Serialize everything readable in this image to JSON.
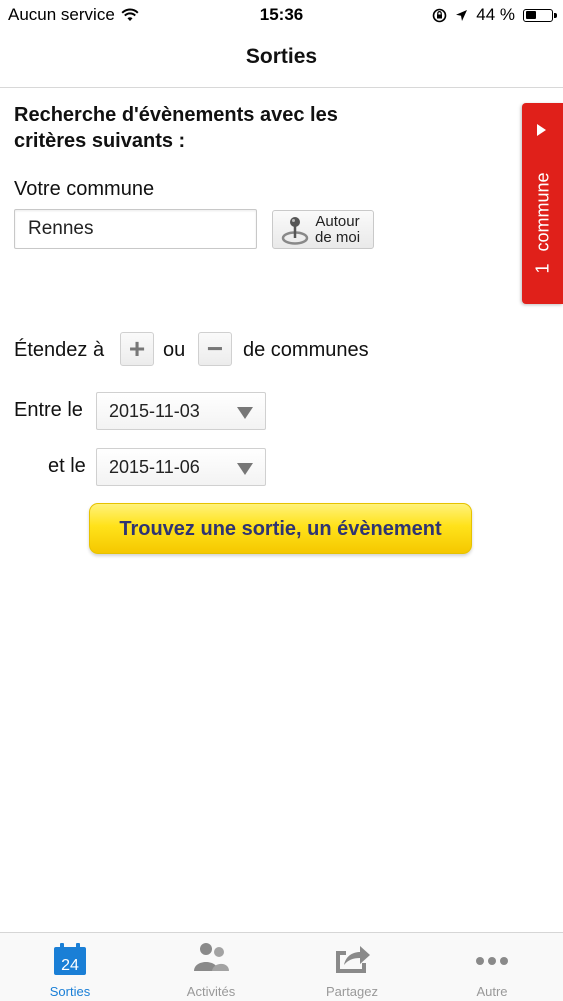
{
  "status_bar": {
    "carrier": "Aucun service",
    "time": "15:36",
    "battery_percent": "44 %",
    "battery_level": 0.44
  },
  "nav": {
    "title": "Sorties"
  },
  "search": {
    "heading": "Recherche d'évènements avec les critères suivants :",
    "commune_label": "Votre commune",
    "commune_value": "Rennes",
    "autour_label_line1": "Autour",
    "autour_label_line2": "de moi"
  },
  "side_tab": {
    "count": "1",
    "label": "commune"
  },
  "extend": {
    "prefix": "Étendez à",
    "plus": "+",
    "or": "ou",
    "minus": "−",
    "suffix": "de communes"
  },
  "dates": {
    "between_label": "Entre le",
    "start": "2015-11-03",
    "and_label": "et le",
    "end": "2015-11-06"
  },
  "cta": {
    "label": "Trouvez une sortie, un évènement"
  },
  "tabbar": {
    "items": [
      {
        "label": "Sorties",
        "icon": "calendar-icon",
        "icon_text": "24",
        "active": true
      },
      {
        "label": "Activités",
        "icon": "people-icon",
        "active": false
      },
      {
        "label": "Partagez",
        "icon": "share-icon",
        "active": false
      },
      {
        "label": "Autre",
        "icon": "more-icon",
        "active": false
      }
    ]
  },
  "colors": {
    "accent_blue": "#1a7fd6",
    "side_tab_red": "#e0201a",
    "cta_yellow": "#ffe21a",
    "cta_text": "#2f3473"
  }
}
